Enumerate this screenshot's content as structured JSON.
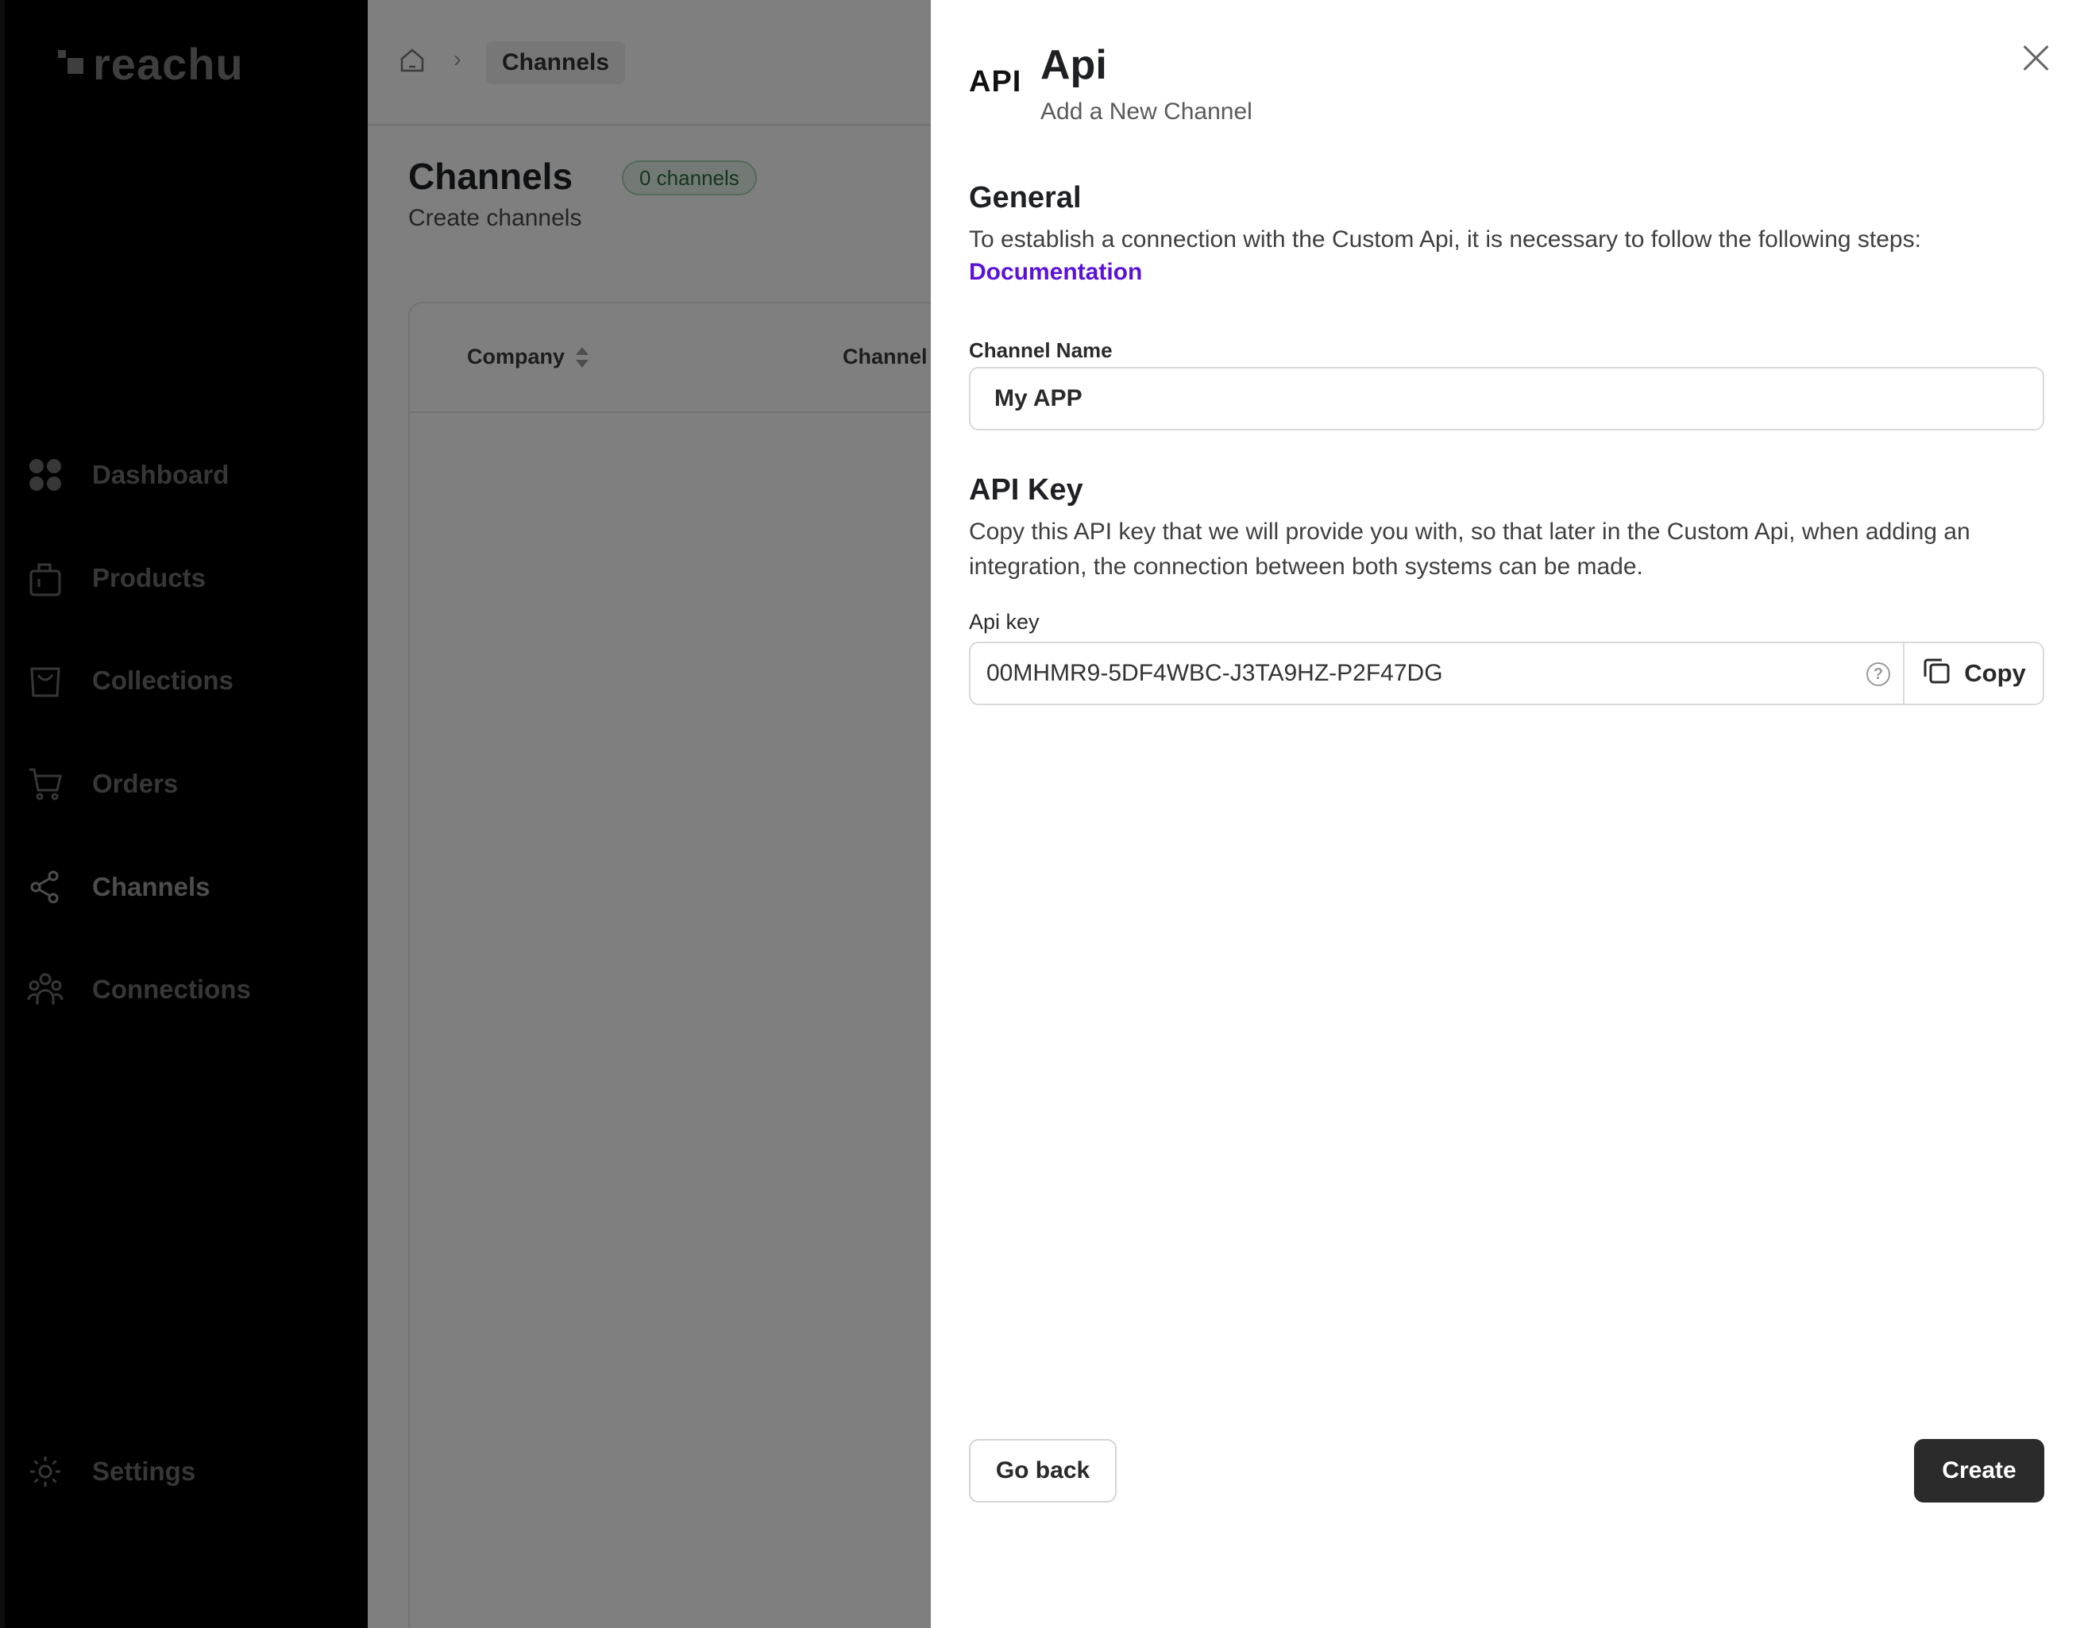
{
  "app": {
    "logo_text": "reachu"
  },
  "sidebar": {
    "items": [
      {
        "label": "Dashboard",
        "icon": "dashboard-icon"
      },
      {
        "label": "Products",
        "icon": "products-icon"
      },
      {
        "label": "Collections",
        "icon": "collections-icon"
      },
      {
        "label": "Orders",
        "icon": "cart-icon"
      },
      {
        "label": "Channels",
        "icon": "share-icon",
        "active": true
      },
      {
        "label": "Connections",
        "icon": "users-icon"
      },
      {
        "label": "Settings",
        "icon": "gear-icon"
      }
    ]
  },
  "breadcrumb": {
    "current": "Channels"
  },
  "page": {
    "title": "Channels",
    "count_badge": "0 channels",
    "subtitle": "Create channels",
    "table": {
      "columns": [
        "Company",
        "Channel"
      ]
    }
  },
  "drawer": {
    "logo_text": "API",
    "title": "Api",
    "subtitle": "Add a New Channel",
    "general": {
      "title": "General",
      "description": "To establish a connection with the Custom Api, it is necessary to follow the following steps:",
      "link_text": "Documentation"
    },
    "channel_name": {
      "label": "Channel Name",
      "value": "My APP"
    },
    "api_key_section": {
      "title": "API Key",
      "description": "Copy this API key that we will provide you with, so that later in the Custom Api, when adding an integration, the connection between both systems can be made."
    },
    "api_key": {
      "label": "Api key",
      "value": "00MHMR9-5DF4WBC-J3TA9HZ-P2F47DG",
      "copy_label": "Copy"
    },
    "buttons": {
      "back": "Go back",
      "create": "Create"
    }
  }
}
